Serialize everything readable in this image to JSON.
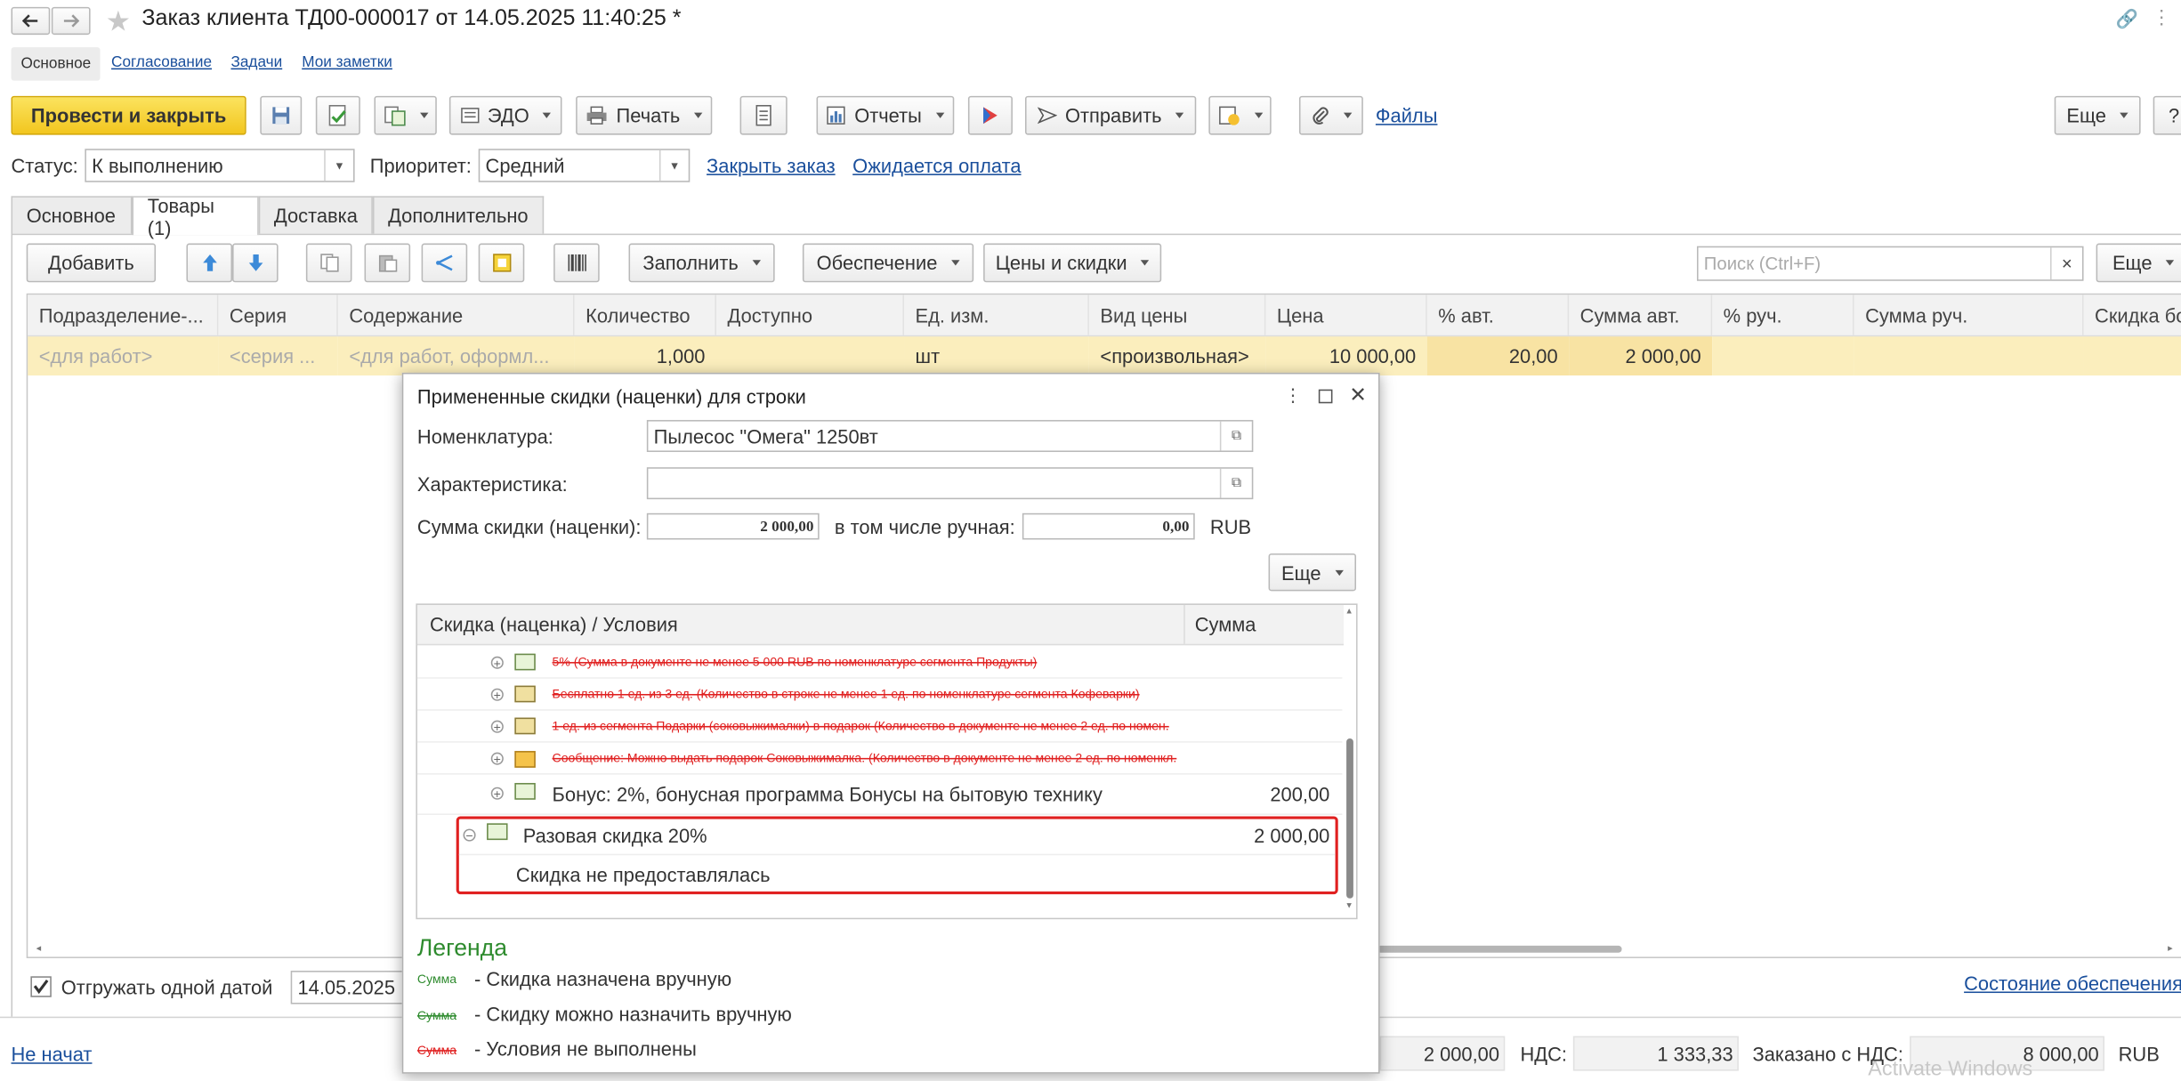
{
  "window": {
    "title": "Заказ клиента ТД00-000017 от 14.05.2025 11:40:25 *"
  },
  "nav_links": [
    "Основное",
    "Согласование",
    "Задачи",
    "Мои заметки"
  ],
  "toolbar": {
    "post_close": "Провести и закрыть",
    "edo": "ЭДО",
    "print": "Печать",
    "reports": "Отчеты",
    "send": "Отправить",
    "files": "Файлы",
    "more": "Еще",
    "help": "?"
  },
  "header": {
    "status_label": "Статус:",
    "status_value": "К выполнению",
    "priority_label": "Приоритет:",
    "priority_value": "Средний",
    "close_order": "Закрыть заказ",
    "awaiting_payment": "Ожидается оплата"
  },
  "tabs": [
    "Основное",
    "Товары (1)",
    "Доставка",
    "Дополнительно"
  ],
  "goods_toolbar": {
    "add": "Добавить",
    "fill": "Заполнить",
    "supply": "Обеспечение",
    "prices": "Цены и скидки",
    "search_placeholder": "Поиск (Ctrl+F)",
    "search_clear": "×",
    "more": "Еще"
  },
  "table": {
    "columns": [
      "Подразделение-...",
      "Серия",
      "Содержание",
      "Количество",
      "Доступно",
      "Ед. изм.",
      "Вид цены",
      "Цена",
      "% авт.",
      "Сумма авт.",
      "% руч.",
      "Сумма руч.",
      "Скидка бо"
    ],
    "row": [
      "<для работ>",
      "<серия ...",
      "<для работ, оформл...",
      "1,000",
      "",
      "шт",
      "<произвольная>",
      "10 000,00",
      "20,00",
      "2 000,00",
      "",
      "",
      ""
    ]
  },
  "footer": {
    "ship_one_date": "Отгружать одной датой",
    "ship_date": "14.05.2025",
    "supply_status": "Состояние обеспечения",
    "not_started": "Не начат",
    "sum_value": "2 000,00",
    "vat_label": "НДС:",
    "vat_value": "1 333,33",
    "ordered_label": "Заказано с НДС:",
    "ordered_value": "8 000,00",
    "currency": "RUB",
    "watermark": "Activate Windows"
  },
  "dialog": {
    "title": "Примененные скидки (наценки) для строки",
    "nomenclature_label": "Номенклатура:",
    "nomenclature_value": "Пылесос \"Омега\" 1250вт",
    "characteristic_label": "Характеристика:",
    "characteristic_value": "",
    "sum_label": "Сумма скидки (наценки):",
    "sum_value": "2 000,00",
    "manual_label": "в том числе ручная:",
    "manual_value": "0,00",
    "currency": "RUB",
    "more": "Еще",
    "grid_col1": "Скидка (наценка) / Условия",
    "grid_col2": "Сумма",
    "rows": [
      {
        "text": "5% (Сумма в документе не менее 5 000 RUB по номенклатуре сегмента Продукты)",
        "sum": "",
        "struck": true,
        "icon": "discount-icon"
      },
      {
        "text": "Бесплатно 1 ед. из 3 ед. (Количество в строке не менее 1 ед. по номенклатуре сегмента Кофеварки)",
        "sum": "",
        "struck": true,
        "icon": "gift-icon"
      },
      {
        "text": "1 ед. из сегмента Подарки (соковыжималки) в подарок (Количество в документе не менее 2 ед. по номен.",
        "sum": "",
        "struck": true,
        "icon": "gift-icon"
      },
      {
        "text": "Сообщение: Можно выдать подарок Соковыжималка. (Количество в документе не менее 2 ед. по номенкл.",
        "sum": "",
        "struck": true,
        "icon": "envelope-icon"
      },
      {
        "text": "Бонус: 2%, бонусная программа Бонусы на бытовую технику",
        "sum": "200,00",
        "struck": false,
        "icon": "discount-icon"
      },
      {
        "text": "Разовая скидка 20%",
        "sum": "2 000,00",
        "struck": false,
        "icon": "discount-icon"
      },
      {
        "text": "Скидка не предоставлялась",
        "sum": "",
        "struck": false,
        "icon": ""
      }
    ],
    "legend_title": "Легенда",
    "legend": [
      {
        "sample": "Сумма",
        "text": "- Скидка назначена вручную",
        "color": "#2e8b2e"
      },
      {
        "sample": "Сумма",
        "text": "- Скидку можно назначить вручную",
        "color": "#2e8b2e"
      },
      {
        "sample": "Сумма",
        "text": "- Условия не выполнены",
        "color": "#e02020"
      }
    ]
  },
  "colors": {
    "accent_yellow": "#f5d33a",
    "highlight_row": "#fbeebd",
    "link": "#1a4f9c",
    "legend_green": "#2e8b2e",
    "strike_red": "#e02020",
    "highlight_border": "#e02020"
  }
}
